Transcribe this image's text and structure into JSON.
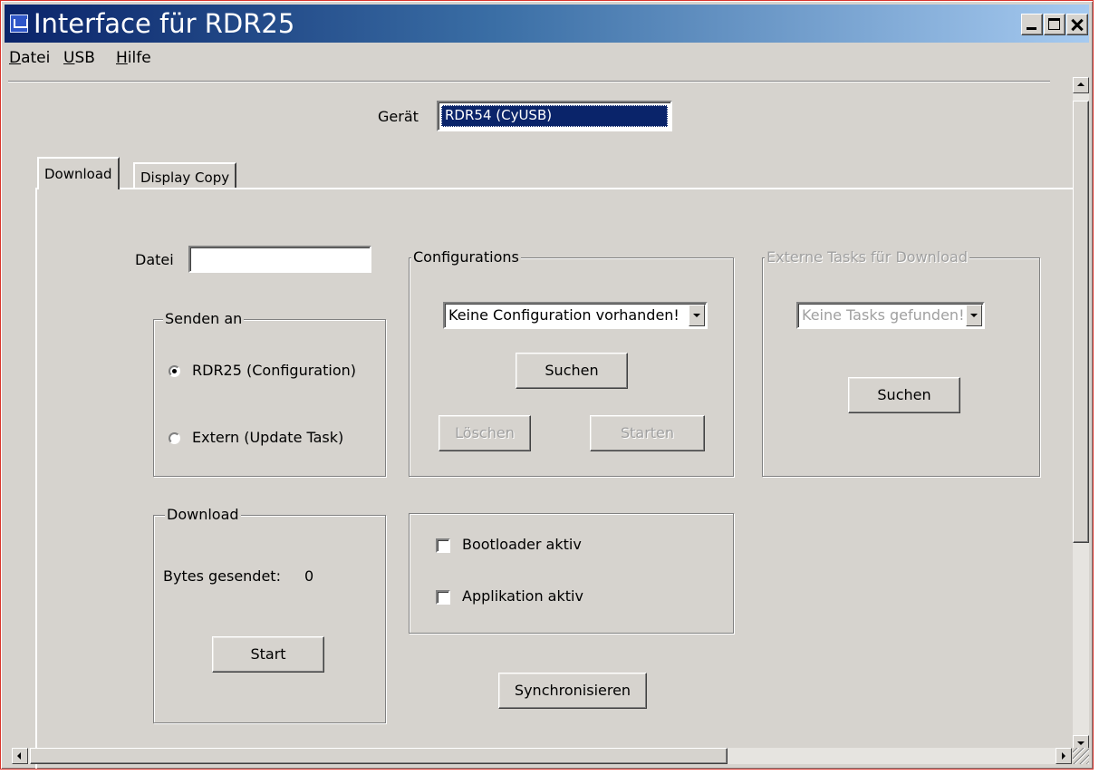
{
  "window": {
    "title": "Interface für RDR25"
  },
  "menu": {
    "items": [
      {
        "mnemonic": "D",
        "rest": "atei"
      },
      {
        "mnemonic": "U",
        "rest": "SB"
      },
      {
        "mnemonic": "H",
        "rest": "ilfe"
      }
    ]
  },
  "device": {
    "label": "Gerät",
    "selected": "RDR54 (CyUSB)"
  },
  "tabs": [
    {
      "label": "Download",
      "active": true
    },
    {
      "label": "Display Copy",
      "active": false
    }
  ],
  "download_tab": {
    "file_label": "Datei",
    "file_value": "",
    "send_to": {
      "title": "Senden an",
      "options": [
        {
          "label": "RDR25 (Configuration)",
          "checked": true
        },
        {
          "label": "Extern (Update Task)",
          "checked": false
        }
      ]
    },
    "configurations": {
      "title": "Configurations",
      "combo_value": "Keine Configuration vorhanden!",
      "search_button": "Suchen",
      "delete_button": "Löschen",
      "start_button": "Starten"
    },
    "external_tasks": {
      "title": "Externe Tasks für Download",
      "combo_value": "Keine Tasks gefunden!",
      "search_button": "Suchen"
    },
    "download_group": {
      "title": "Download",
      "bytes_label": "Bytes gesendet:",
      "bytes_value": "0",
      "start_button": "Start"
    },
    "flags": {
      "bootloader_label": "Bootloader aktiv",
      "bootloader_checked": false,
      "application_label": "Applikation aktiv",
      "application_checked": false
    },
    "sync_button": "Synchronisieren"
  },
  "colors": {
    "titlebar_start": "#0a246a",
    "titlebar_end": "#a6caf0",
    "window_face": "#d6d3ce",
    "selection": "#0a246a",
    "disabled_text": "#a0a0a0"
  }
}
